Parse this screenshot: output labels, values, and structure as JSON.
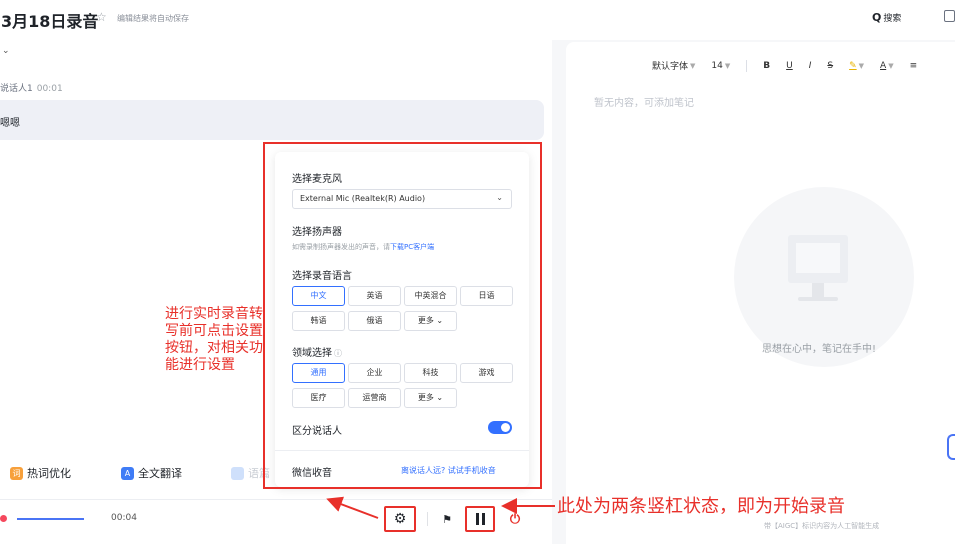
{
  "header": {
    "title": "3月18日录音",
    "autosave": "编辑结果将自动保存",
    "search_label": "搜索"
  },
  "transcript": {
    "speaker_name": "说话人1",
    "speaker_time": "00:01",
    "utterance": "嗯嗯"
  },
  "tools": {
    "hotword": "热词优化",
    "translate": "全文翻译",
    "third": "语篇"
  },
  "player": {
    "time": "00:04"
  },
  "notes": {
    "font": "默认字体",
    "size": "14",
    "bold": "B",
    "underline": "U",
    "italic": "I",
    "strike": "S",
    "color": "A",
    "empty": "暂无内容，可添加笔记",
    "slogan": "思想在心中，笔记在手中!",
    "aigc": "带【AIGC】标识内容为人工智能生成"
  },
  "settings": {
    "mic_label": "选择麦克风",
    "mic_value": "External Mic (Realtek(R) Audio)",
    "speaker_label": "选择扬声器",
    "speaker_hint": "如需录制扬声器发出的声音，请",
    "speaker_link": "下载PC客户端",
    "lang_label": "选择录音语言",
    "languages": [
      "中文",
      "英语",
      "中英混合",
      "日语",
      "韩语",
      "俄语",
      "更多"
    ],
    "selected_language": "中文",
    "domain_label": "领域选择",
    "domains": [
      "通用",
      "企业",
      "科技",
      "游戏",
      "医疗",
      "运营商",
      "更多"
    ],
    "selected_domain": "通用",
    "diarize_label": "区分说话人",
    "diarize_on": true,
    "wechat_label": "微信收音",
    "wechat_link": "离说话人远? 试试手机收音"
  },
  "annotations": {
    "left": "进行实时录音转写前可点击设置按钮，对相关功能进行设置",
    "right": "此处为两条竖杠状态，即为开始录音"
  },
  "colors": {
    "accent": "#3370ff",
    "annotation": "#e8302a"
  }
}
